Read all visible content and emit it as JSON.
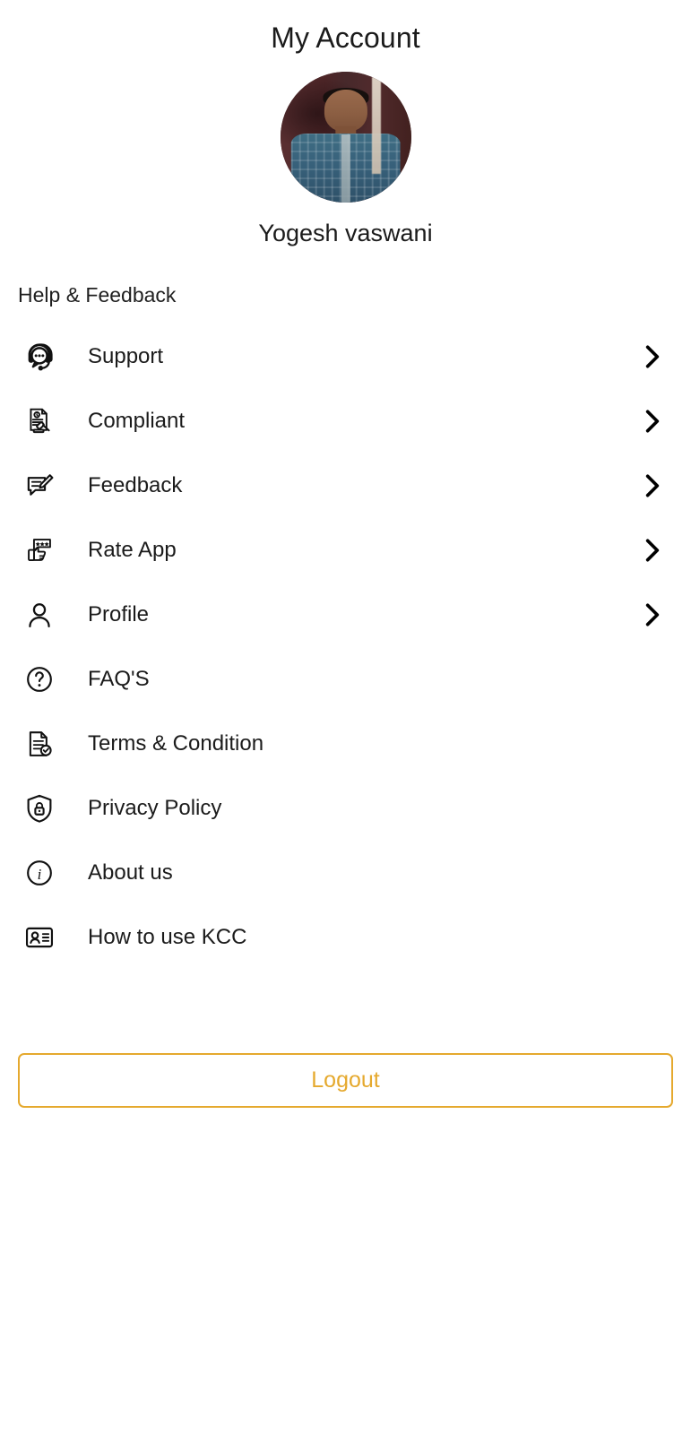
{
  "header": {
    "title": "My Account",
    "profile_name": "Yogesh vaswani",
    "avatar_alt": "user-avatar-photo"
  },
  "section": {
    "title": "Help & Feedback"
  },
  "menu": {
    "items": [
      {
        "label": "Support",
        "icon": "headset-support-icon",
        "chevron": true
      },
      {
        "label": "Compliant",
        "icon": "document-gavel-icon",
        "chevron": true
      },
      {
        "label": "Feedback",
        "icon": "message-pencil-icon",
        "chevron": true
      },
      {
        "label": "Rate App",
        "icon": "hand-stars-rating-icon",
        "chevron": true
      },
      {
        "label": "Profile",
        "icon": "person-icon",
        "chevron": true
      },
      {
        "label": "FAQ'S",
        "icon": "question-circle-icon",
        "chevron": false
      },
      {
        "label": "Terms & Condition",
        "icon": "document-check-icon",
        "chevron": false
      },
      {
        "label": "Privacy Policy",
        "icon": "shield-lock-icon",
        "chevron": false
      },
      {
        "label": "About us",
        "icon": "info-circle-icon",
        "chevron": false
      },
      {
        "label": "How to use KCC",
        "icon": "id-card-icon",
        "chevron": false
      }
    ]
  },
  "footer": {
    "logout_label": "Logout"
  },
  "colors": {
    "accent": "#e5a92e",
    "text": "#1b1b1b",
    "icon": "#111111",
    "background": "#ffffff"
  }
}
